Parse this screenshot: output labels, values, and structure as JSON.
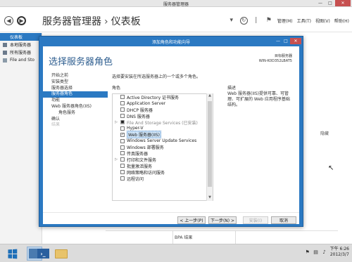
{
  "window": {
    "title": "服务器管理器",
    "minimize": "—",
    "maximize": "□",
    "close": "✕"
  },
  "nav": {
    "breadcrumb_app": "服务器管理器",
    "breadcrumb_sep": "›",
    "breadcrumb_page": "仪表板",
    "menu_manage": "管理(M)",
    "menu_tools": "工具(T)",
    "menu_view": "视图(V)",
    "menu_help": "帮助(H)"
  },
  "sidebar": {
    "items": [
      {
        "label": "仪表板",
        "active": true
      },
      {
        "label": "本地服务器",
        "active": false
      },
      {
        "label": "所有服务器",
        "active": false
      },
      {
        "label": "File and Sto",
        "active": false
      }
    ]
  },
  "background": {
    "hide_label": "隐藏",
    "bpa_label": "BPA 结果"
  },
  "dialog": {
    "title": "添加角色和功能向导",
    "heading": "选择服务器角色",
    "target_label": "目标服务器",
    "target_value": "WIN-K0D352LBAT5",
    "description_line": "选择要安装在所选服务器上的一个或多个角色。",
    "roles_header": "角色",
    "desc_header": "描述",
    "description": "Web 服务器(IIS)提供可靠、可管理、可扩展的 Web 应用程序基础结构。",
    "steps": [
      {
        "label": "开始之前",
        "state": "normal",
        "sub": false
      },
      {
        "label": "安装类型",
        "state": "normal",
        "sub": false
      },
      {
        "label": "服务器选择",
        "state": "normal",
        "sub": false
      },
      {
        "label": "服务器角色",
        "state": "active",
        "sub": false
      },
      {
        "label": "功能",
        "state": "normal",
        "sub": false
      },
      {
        "label": "Web 服务器角色(IIS)",
        "state": "normal",
        "sub": false
      },
      {
        "label": "角色服务",
        "state": "normal",
        "sub": true
      },
      {
        "label": "确认",
        "state": "normal",
        "sub": false
      },
      {
        "label": "结果",
        "state": "disabled",
        "sub": false
      }
    ],
    "roles": [
      {
        "label": "Active Directory 证书服务",
        "checked": false,
        "expandable": false,
        "installed": false,
        "selected": false
      },
      {
        "label": "Application Server",
        "checked": false,
        "expandable": false,
        "installed": false,
        "selected": false
      },
      {
        "label": "DHCP 服务器",
        "checked": false,
        "expandable": false,
        "installed": false,
        "selected": false
      },
      {
        "label": "DNS 服务器",
        "checked": false,
        "expandable": false,
        "installed": false,
        "selected": false
      },
      {
        "label": "File And Storage Services (已安装)",
        "checked": true,
        "expandable": true,
        "installed": true,
        "selected": false
      },
      {
        "label": "Hyper-V",
        "checked": false,
        "expandable": false,
        "installed": false,
        "selected": false
      },
      {
        "label": "Web 服务器(IIS)",
        "checked": true,
        "expandable": false,
        "installed": false,
        "selected": true
      },
      {
        "label": "Windows Server Update Services",
        "checked": false,
        "expandable": false,
        "installed": false,
        "selected": false
      },
      {
        "label": "Windows 部署服务",
        "checked": false,
        "expandable": false,
        "installed": false,
        "selected": false
      },
      {
        "label": "传真服务器",
        "checked": false,
        "expandable": false,
        "installed": false,
        "selected": false
      },
      {
        "label": "打印和文件服务",
        "checked": false,
        "expandable": true,
        "installed": false,
        "selected": false
      },
      {
        "label": "批量激活服务",
        "checked": false,
        "expandable": false,
        "installed": false,
        "selected": false
      },
      {
        "label": "网络策略和访问服务",
        "checked": false,
        "expandable": false,
        "installed": false,
        "selected": false
      },
      {
        "label": "远程访问",
        "checked": false,
        "expandable": false,
        "installed": false,
        "selected": false
      }
    ],
    "buttons": {
      "prev": "< 上一步(P)",
      "next": "下一步(N) >",
      "install": "安装(I)",
      "cancel": "取消"
    }
  },
  "taskbar": {
    "powershell_glyph": "›_",
    "time": "下午 6:26",
    "date": "2012/3/7"
  }
}
